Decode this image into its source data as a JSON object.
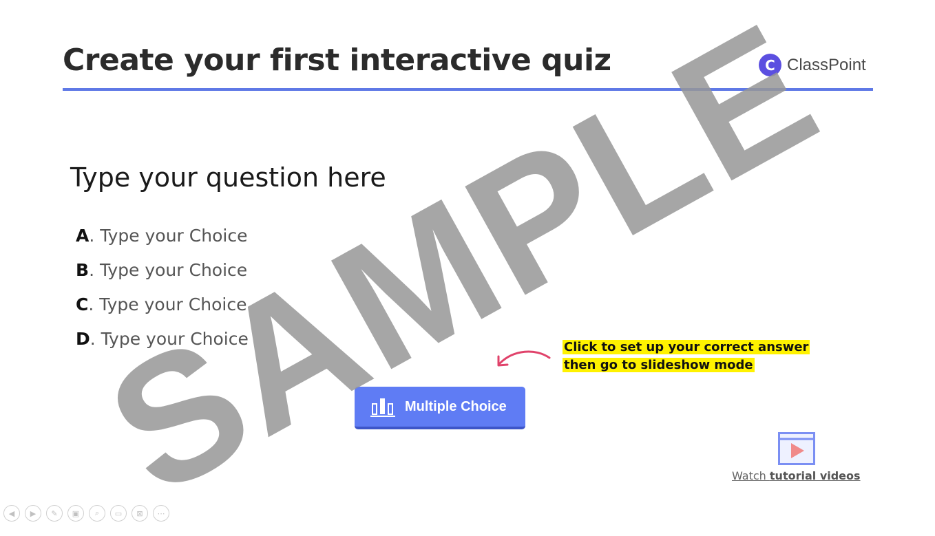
{
  "slide": {
    "title": "Create your first interactive quiz",
    "logo_text": "ClassPoint",
    "question": "Type your question here",
    "choices": [
      {
        "letter": "A",
        "text": ". Type your Choice"
      },
      {
        "letter": "B",
        "text": ". Type your Choice"
      },
      {
        "letter": "C",
        "text": ". Type your Choice"
      },
      {
        "letter": "D",
        "text": ". Type your Choice"
      }
    ],
    "hint_line1": "Click to set up your correct answer",
    "hint_line2": "then go to slideshow mode",
    "button_label": "Multiple Choice",
    "watch_prefix": "Watch ",
    "watch_bold": "tutorial videos",
    "watermark": "SAMPLE"
  },
  "colors": {
    "accent": "#5f79e6",
    "button": "#5f7cf4",
    "highlight": "#fff200",
    "arrow": "#e0426a",
    "logo": "#5b4fe0"
  },
  "icons": {
    "logo": "classpoint-logo-icon",
    "button": "bar-chart-icon",
    "video": "play-video-icon",
    "nav": [
      "previous-icon",
      "next-icon",
      "pen-icon",
      "slides-icon",
      "zoom-icon",
      "subtitles-icon",
      "camera-off-icon",
      "more-icon"
    ]
  }
}
